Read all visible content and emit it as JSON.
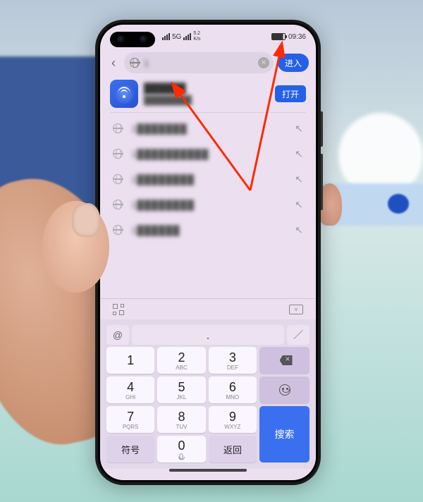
{
  "status": {
    "signal_label": "5G",
    "speed_top": "5.2",
    "speed_bottom": "K/s",
    "time": "09:36"
  },
  "addr": {
    "value": "1",
    "enter_label": "进入"
  },
  "result": {
    "title": "██████",
    "subtitle": "████████",
    "open_label": "打开"
  },
  "history": [
    "1███████",
    "1██████████",
    "1████████",
    "1████████",
    "1██████"
  ],
  "keyboard": {
    "at": "@",
    "nums": [
      {
        "d": "1",
        "s": ""
      },
      {
        "d": "2",
        "s": "ABC"
      },
      {
        "d": "3",
        "s": "DEF"
      },
      {
        "d": "4",
        "s": "GHI"
      },
      {
        "d": "5",
        "s": "JKL"
      },
      {
        "d": "6",
        "s": "MNO"
      },
      {
        "d": "7",
        "s": "PQRS"
      },
      {
        "d": "8",
        "s": "TUV"
      },
      {
        "d": "9",
        "s": "WXYZ"
      }
    ],
    "fn_symbol": "符号",
    "zero": "0",
    "fn_return": "返回",
    "search_label": "搜索",
    "dot": "."
  }
}
